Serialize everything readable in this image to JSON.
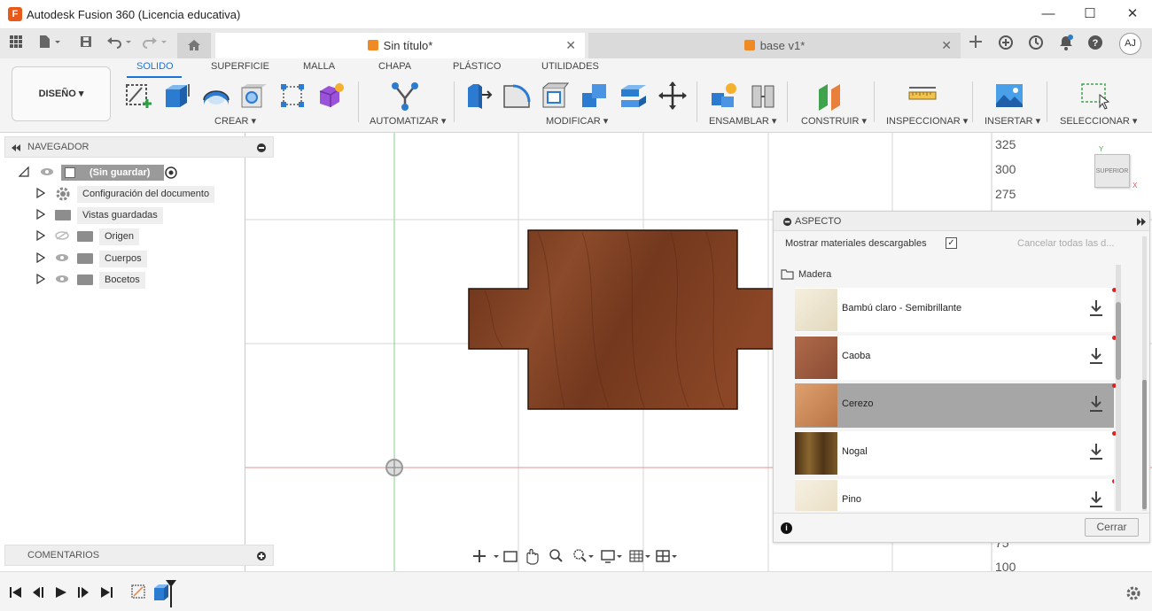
{
  "window": {
    "title": "Autodesk Fusion 360 (Licencia educativa)",
    "logo_letter": "F",
    "minimize": "—",
    "maximize": "☐",
    "close": "✕"
  },
  "tabs": [
    {
      "label": "Sin título*",
      "active": true
    },
    {
      "label": "base v1*",
      "active": false
    }
  ],
  "user": {
    "initials": "AJ"
  },
  "ribbon": {
    "workspace_button": "DISEÑO ▾",
    "tabs": [
      "SOLIDO",
      "SUPERFICIE",
      "MALLA",
      "CHAPA",
      "PLÁSTICO",
      "UTILIDADES"
    ],
    "active_tab": "SOLIDO",
    "groups": [
      "CREAR ▾",
      "AUTOMATIZAR ▾",
      "MODIFICAR ▾",
      "ENSAMBLAR ▾",
      "CONSTRUIR ▾",
      "INSPECCIONAR ▾",
      "INSERTAR ▾",
      "SELECCIONAR ▾"
    ]
  },
  "navigator": {
    "title": "NAVEGADOR",
    "root": "(Sin guardar)",
    "items": [
      {
        "label": "Configuración del documento"
      },
      {
        "label": "Vistas guardadas"
      },
      {
        "label": "Origen"
      },
      {
        "label": "Cuerpos"
      },
      {
        "label": "Bocetos"
      }
    ]
  },
  "comments": {
    "title": "COMENTARIOS"
  },
  "ruler": {
    "ticks_top": [
      "325",
      "300",
      "275"
    ],
    "ticks_bottom": [
      "75",
      "100"
    ]
  },
  "viewcube": {
    "label": "SUPERIOR",
    "axis_x": "X",
    "axis_y": "Y"
  },
  "appearance": {
    "title": "ASPECTO",
    "show_downloadable_label": "Mostrar materiales descargables",
    "show_downloadable_checked": true,
    "cancel_all_label": "Cancelar todas las d...",
    "category": "Madera",
    "materials": [
      {
        "name": "Bambú claro - Semibrillante",
        "selected": false,
        "color": "#ece4cf"
      },
      {
        "name": "Caoba",
        "selected": false,
        "color": "#9b5a3f"
      },
      {
        "name": "Cerezo",
        "selected": true,
        "color": "#c8875a"
      },
      {
        "name": "Nogal",
        "selected": false,
        "color": "#6b4722"
      },
      {
        "name": "Pino",
        "selected": false,
        "color": "#f1e9d7"
      }
    ],
    "info_icon": "i",
    "close_button": "Cerrar"
  },
  "colors": {
    "wood": "#7a3e24",
    "accent": "#1a73d9",
    "axis_red": "#e06060",
    "axis_green": "#60c060"
  }
}
